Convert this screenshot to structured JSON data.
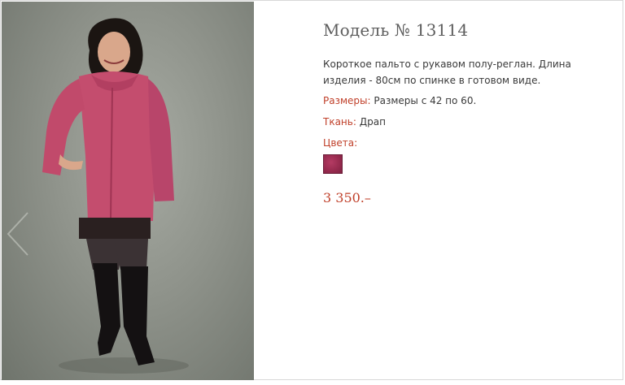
{
  "product": {
    "title": "Модель № 13114",
    "description": "Короткое пальто с рукавом полу-реглан. Длина изделия - 80см по спинке в готовом виде.",
    "sizes_label": "Размеры:",
    "sizes_value": "Размеры с 42 по 60.",
    "fabric_label": "Ткань:",
    "fabric_value": "Драп",
    "colors_label": "Цвета:",
    "colors": [
      {
        "name": "малиновый",
        "hex": "#a3305a"
      }
    ],
    "price": "3 350.–"
  },
  "gallery": {
    "prev_icon": "chevron-left-icon",
    "photo_alt": "Модель № 13114"
  },
  "theme": {
    "accent": "#c0402a",
    "text": "#3a3a3a",
    "title": "#5d5d5d"
  }
}
